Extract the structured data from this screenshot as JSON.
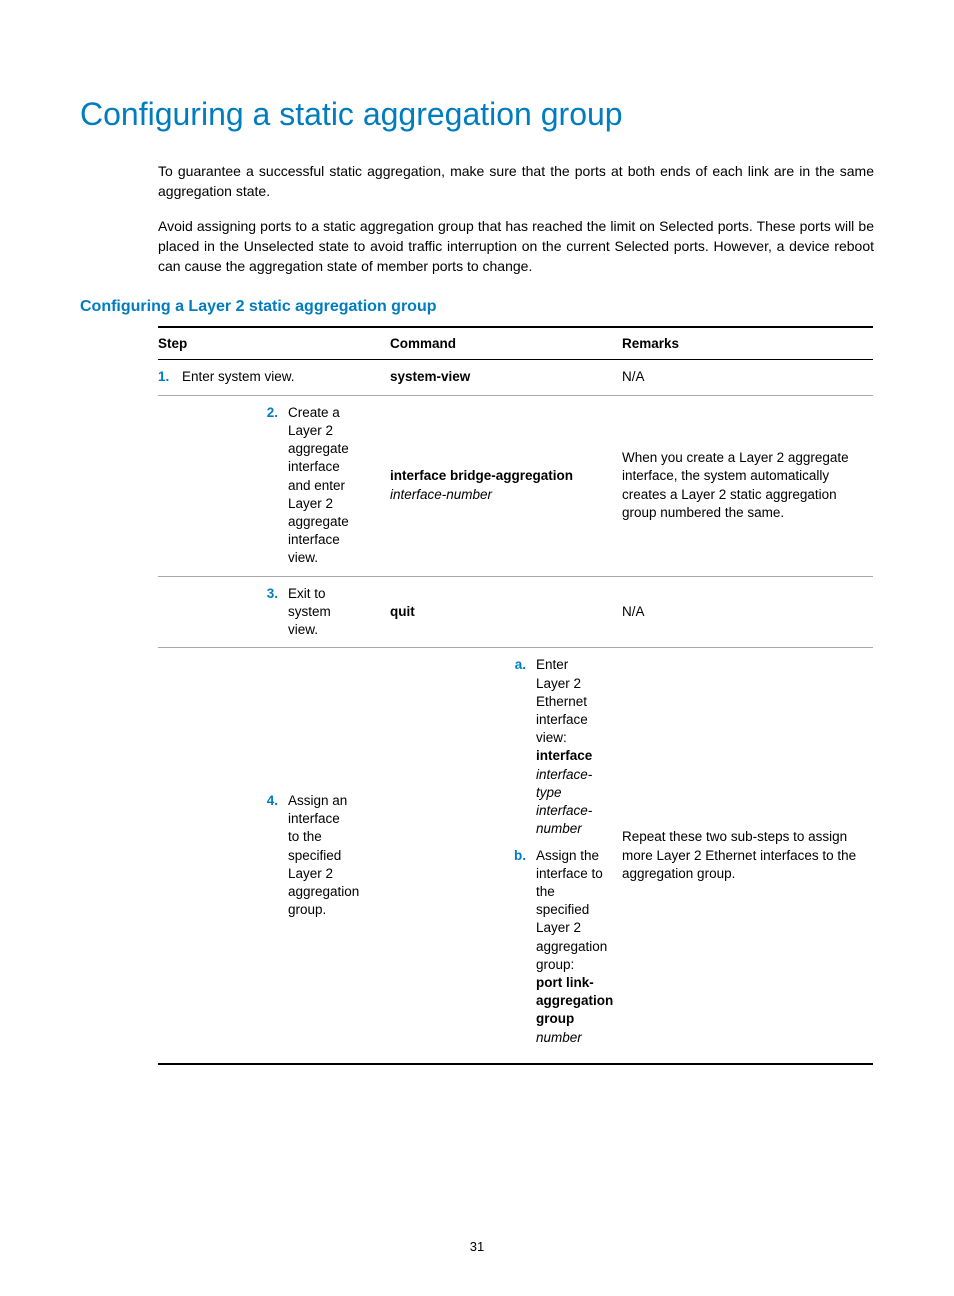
{
  "title": "Configuring a static aggregation group",
  "para1": "To guarantee a successful static aggregation, make sure that the ports at both ends of each link are in the same aggregation state.",
  "para2": "Avoid assigning ports to a static aggregation group that has reached the limit on Selected ports. These ports will be placed in the Unselected state to avoid traffic interruption on the current Selected ports. However, a device reboot can cause the aggregation state of member ports to change.",
  "subtitle": "Configuring a Layer 2 static aggregation group",
  "headers": {
    "step": "Step",
    "command": "Command",
    "remarks": "Remarks"
  },
  "rows": {
    "r1": {
      "num": "1.",
      "step": "Enter system view.",
      "cmd_bold": "system-view",
      "remarks": "N/A"
    },
    "r2": {
      "num": "2.",
      "step": "Create a Layer 2 aggregate interface and enter Layer 2 aggregate interface view.",
      "cmd_bold": "interface bridge-aggregation",
      "cmd_italic": "interface-number",
      "remarks": "When you create a Layer 2 aggregate interface, the system automatically creates a Layer 2 static aggregation group numbered the same."
    },
    "r3": {
      "num": "3.",
      "step": "Exit to system view.",
      "cmd_bold": "quit",
      "remarks": "N/A"
    },
    "r4": {
      "num": "4.",
      "step": "Assign an interface to the specified Layer 2 aggregation group.",
      "sub_a_letter": "a.",
      "sub_a_text": "Enter Layer 2 Ethernet interface view:",
      "sub_a_cmd_bold": "interface",
      "sub_a_cmd_italic": "interface-type interface-number",
      "sub_b_letter": "b.",
      "sub_b_text": "Assign the interface to the specified Layer 2 aggregation group:",
      "sub_b_cmd_bold": "port link-aggregation group",
      "sub_b_cmd_italic": "number",
      "remarks": "Repeat these two sub-steps to assign more Layer 2 Ethernet interfaces to the aggregation group."
    }
  },
  "page_number": "31"
}
